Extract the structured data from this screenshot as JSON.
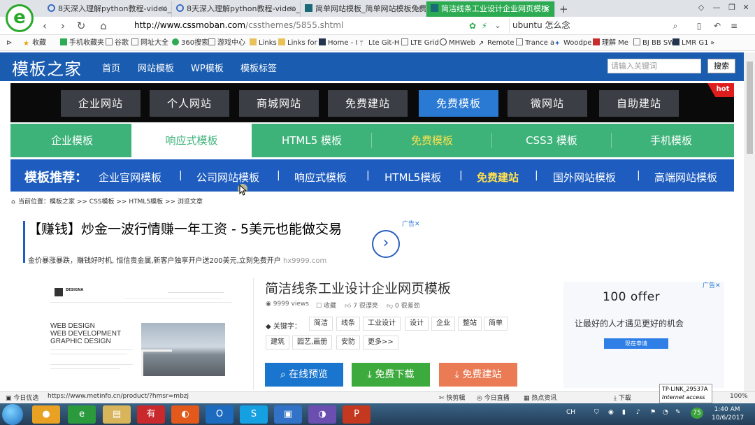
{
  "browser": {
    "tabs": [
      {
        "title": "8天深入理解python教程-video_",
        "active": false
      },
      {
        "title": "8天深入理解python教程-video_",
        "active": false
      },
      {
        "title": "简单网站模板_简单网站模板免费",
        "active": false
      },
      {
        "title": "简洁线条工业设计企业网页模板",
        "active": true
      }
    ],
    "new_tab": "+",
    "url_host": "http://www.cssmoban.com",
    "url_path": "/cssthemes/5855.shtml",
    "search_text": "ubuntu 怎么念",
    "bookmarks": [
      "收藏",
      "手机收藏夹",
      "谷歌",
      "网址大全",
      "360搜索",
      "游戏中心",
      "Links",
      "Links for",
      "Home - I",
      "Lte Git-H",
      "LTE Grid",
      "MHWeb",
      "Remote",
      "Trance a",
      "Woodpe",
      "理解 Me",
      "BJ BB SW",
      "LMR G1"
    ]
  },
  "site": {
    "logo": "模板之家",
    "nav": [
      "首页",
      "网站模板",
      "WP模板",
      "模板标签"
    ],
    "search_placeholder": "请输入关键词",
    "search_button": "搜索",
    "categories": [
      "企业网站",
      "个人网站",
      "商城网站",
      "免费建站",
      "免费模板",
      "微网站",
      "自助建站"
    ],
    "hot_badge": "hot",
    "template_tabs": [
      "企业模板",
      "响应式模板",
      "HTML5 模板",
      "免费模板",
      "CSS3 模板",
      "手机模板"
    ],
    "recommend_label": "模板推荐：",
    "recommend_items": [
      "企业官网模板",
      "公司网站模板",
      "响应式模板",
      "HTML5模板",
      "免费建站",
      "国外网站模板",
      "高端网站模板"
    ],
    "breadcrumb": "当前位置：模板之家 >> CSS模板 >> HTML5模板 >> 浏览文章"
  },
  "ad": {
    "title": "【赚钱】炒金一波行情赚一年工资 - 5美元也能做交易",
    "subtitle": "金价暴涨暴跌，赚钱好时机, 恒信贵金属,新客户独享开户送200美元,立刻免费开户",
    "domain": "hx9999.com",
    "tag": "广告✕"
  },
  "preview": {
    "brand": "DESIGNA",
    "headline": [
      "WEB DESIGN",
      "WEB DEVELOPMENT",
      "GRAPHIC DESIGN"
    ]
  },
  "detail": {
    "title": "简洁线条工业设计企业网页模板",
    "views": "9999 views",
    "favorite": "收藏",
    "likes": "7 很漂亮",
    "dislikes": "0 很差劲",
    "keywords_label": "关键字：",
    "keywords": [
      "简洁",
      "线条",
      "工业设计",
      "设计",
      "企业",
      "整站",
      "简单",
      "建筑",
      "园艺,画册",
      "安防",
      "更多>>"
    ],
    "btn_preview": "在线预览",
    "btn_download": "免费下载",
    "btn_build": "免费建站"
  },
  "right_ad": {
    "tag": "广告✕",
    "logo": "100 offer",
    "text": "让最好的人才遇见更好的机会",
    "button": "现在申请"
  },
  "statusbar": {
    "left": "今日优选",
    "url": "https://www.metinfo.cn/product/?hmsr=mbzj",
    "items": [
      "快剪辑",
      "今日直播",
      "热点资讯",
      "下载"
    ],
    "zoom": "100%",
    "network_name": "TP-LINK_29537A",
    "network_status": "Internet access"
  },
  "taskbar": {
    "lang": "CH",
    "time": "1:40 AM",
    "date": "10/6/2017",
    "badge": "75"
  }
}
